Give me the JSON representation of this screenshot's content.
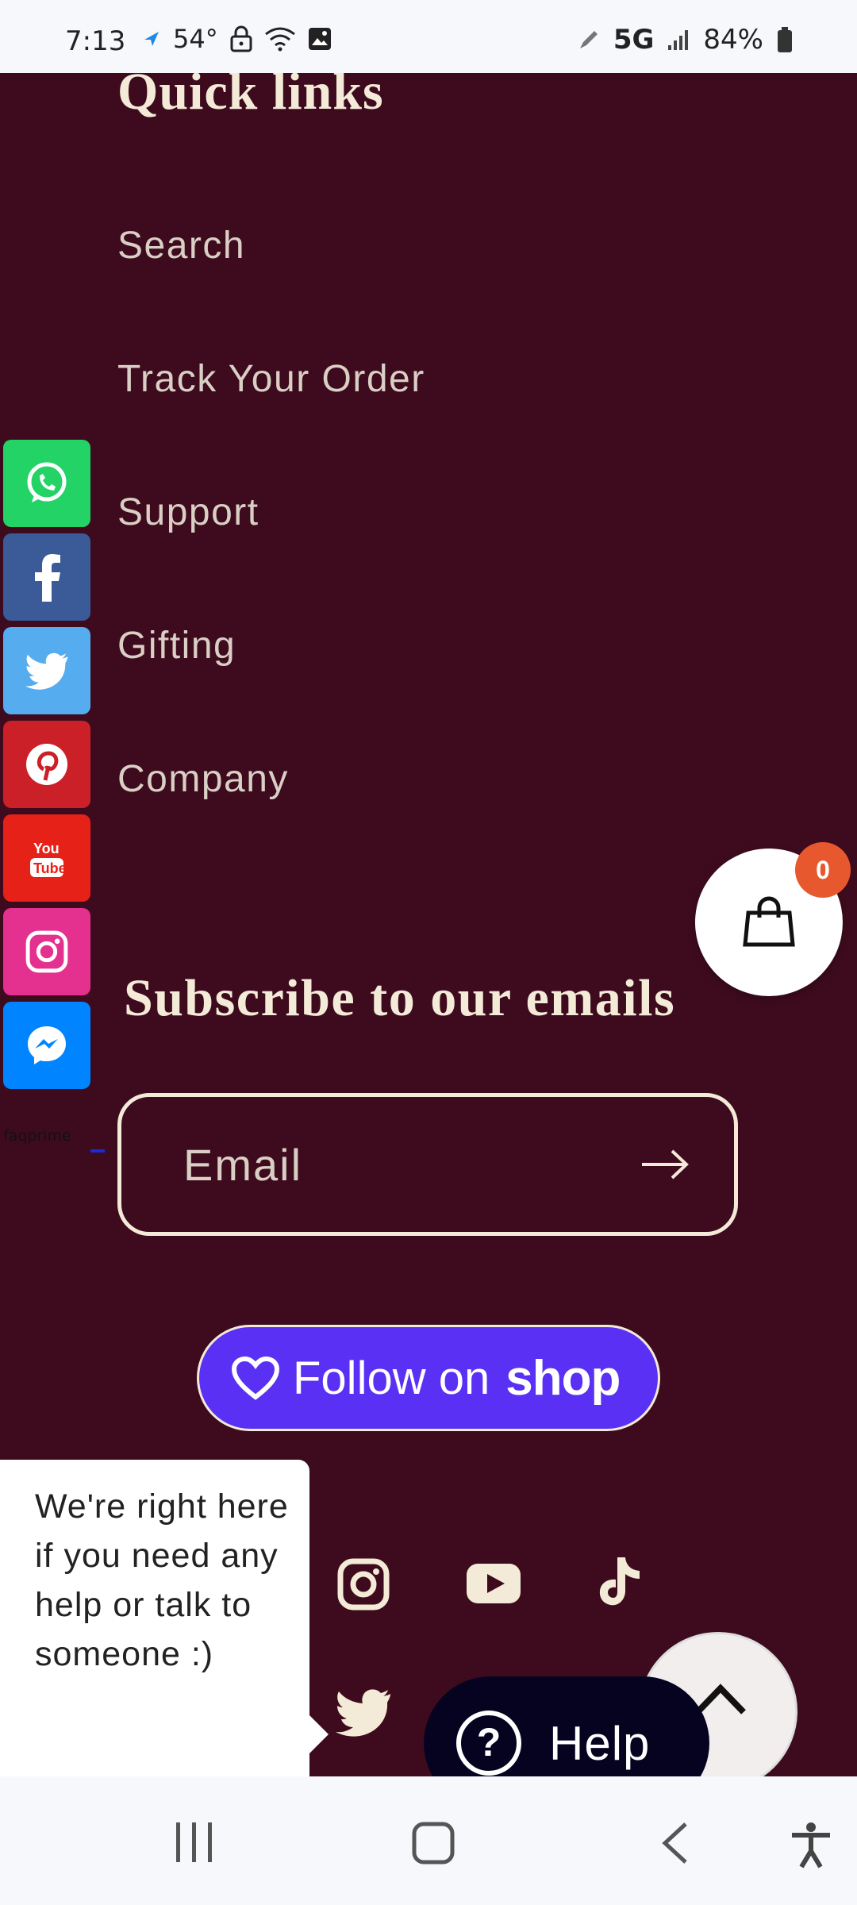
{
  "status_bar": {
    "time": "7:13",
    "left_icons": [
      "location-icon",
      "temperature-icon",
      "lock-icon",
      "wifi-icon",
      "gallery-icon"
    ],
    "temperature": "54°",
    "network": "5G",
    "battery": "84%"
  },
  "footer": {
    "quick_links_title": "Quick links",
    "links": [
      {
        "label": "Search"
      },
      {
        "label": "Track Your Order"
      },
      {
        "label": "Support"
      },
      {
        "label": "Gifting"
      },
      {
        "label": "Company"
      }
    ],
    "subscribe_title": "Subscribe to our emails",
    "email_placeholder": "Email",
    "follow_label": "Follow on",
    "shop_brand": "shop"
  },
  "share_bar": {
    "items": [
      "whatsapp",
      "facebook",
      "twitter",
      "pinterest",
      "youtube",
      "instagram",
      "messenger"
    ],
    "credit": "faqprime"
  },
  "cart": {
    "count": "0"
  },
  "chat": {
    "tooltip": "We're right here if you need any help or talk to someone :)",
    "help_label": "Help"
  },
  "colors": {
    "background": "#3e0b1e",
    "cream": "#f3ead7",
    "shop_purple": "#5a31f4",
    "badge": "#e8582e",
    "help_bg": "#050320"
  }
}
